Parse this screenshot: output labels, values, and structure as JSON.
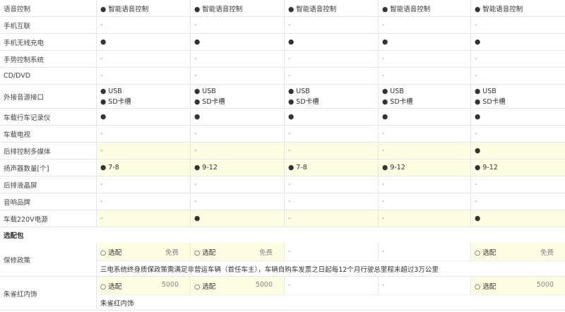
{
  "rows": [
    {
      "label": "语音控制",
      "hl": false,
      "values": [
        "● 智能语音控制",
        "● 智能语音控制",
        "● 智能语音控制",
        "● 智能语音控制",
        "● 智能语音控制"
      ]
    },
    {
      "label": "手机互联",
      "hl": false,
      "values": [
        "-",
        "-",
        "-",
        "-",
        "-"
      ]
    },
    {
      "label": "手机无线充电",
      "hl": false,
      "values": [
        "●",
        "●",
        "●",
        "●",
        "●"
      ]
    },
    {
      "label": "手势控制系统",
      "hl": false,
      "values": [
        "-",
        "-",
        "-",
        "-",
        "-"
      ]
    },
    {
      "label": "CD/DVD",
      "hl": false,
      "values": [
        "-",
        "-",
        "-",
        "-",
        "-"
      ]
    },
    {
      "label": "外接音源接口",
      "hl": false,
      "multi": true,
      "values": [
        [
          "● USB",
          "● SD卡槽"
        ],
        [
          "● USB",
          "● SD卡槽"
        ],
        [
          "● USB",
          "● SD卡槽"
        ],
        [
          "● USB",
          "● SD卡槽"
        ],
        [
          "● USB",
          "● SD卡槽"
        ]
      ]
    },
    {
      "label": "车载行车记录仪",
      "hl": false,
      "values": [
        "●",
        "●",
        "●",
        "●",
        "●"
      ]
    },
    {
      "label": "车载电视",
      "hl": false,
      "values": [
        "-",
        "-",
        "-",
        "-",
        "-"
      ]
    },
    {
      "label": "后排控制多媒体",
      "hl": true,
      "values": [
        "-",
        "-",
        "-",
        "-",
        "●"
      ]
    },
    {
      "label": "扬声器数量[个]",
      "hl": true,
      "values": [
        "● 7-8",
        "● 9-12",
        "● 7-8",
        "● 9-12",
        "● 9-12"
      ]
    },
    {
      "label": "后排液晶屏",
      "hl": false,
      "values": [
        "-",
        "-",
        "-",
        "-",
        "-"
      ]
    },
    {
      "label": "音响品牌",
      "hl": false,
      "values": [
        "-",
        "-",
        "-",
        "-",
        "-"
      ]
    },
    {
      "label": "车载220V电源",
      "hl": true,
      "values": [
        "-",
        "●",
        "-",
        "-",
        "●"
      ]
    }
  ],
  "section_title": "选配包",
  "packages": [
    {
      "label": "保修政策",
      "options": [
        {
          "text": "○ 选配",
          "price": "免费"
        },
        {
          "text": "○ 选配",
          "price": "免费"
        },
        {
          "text": "-",
          "price": ""
        },
        {
          "text": "-",
          "price": ""
        },
        {
          "text": "○ 选配",
          "price": "免费"
        }
      ],
      "note": "三电系统终身质保政策需满足非营运车辆（首任车主），车辆自购车发票之日起每12个月行驶总里程未超过3万公里"
    },
    {
      "label": "朱雀红内饰",
      "options": [
        {
          "text": "○ 选配",
          "price": "5000"
        },
        {
          "text": "○ 选配",
          "price": "5000"
        },
        {
          "text": "-",
          "price": ""
        },
        {
          "text": "-",
          "price": ""
        },
        {
          "text": "○ 选配",
          "price": "5000"
        }
      ],
      "note": "朱雀红内饰"
    }
  ]
}
